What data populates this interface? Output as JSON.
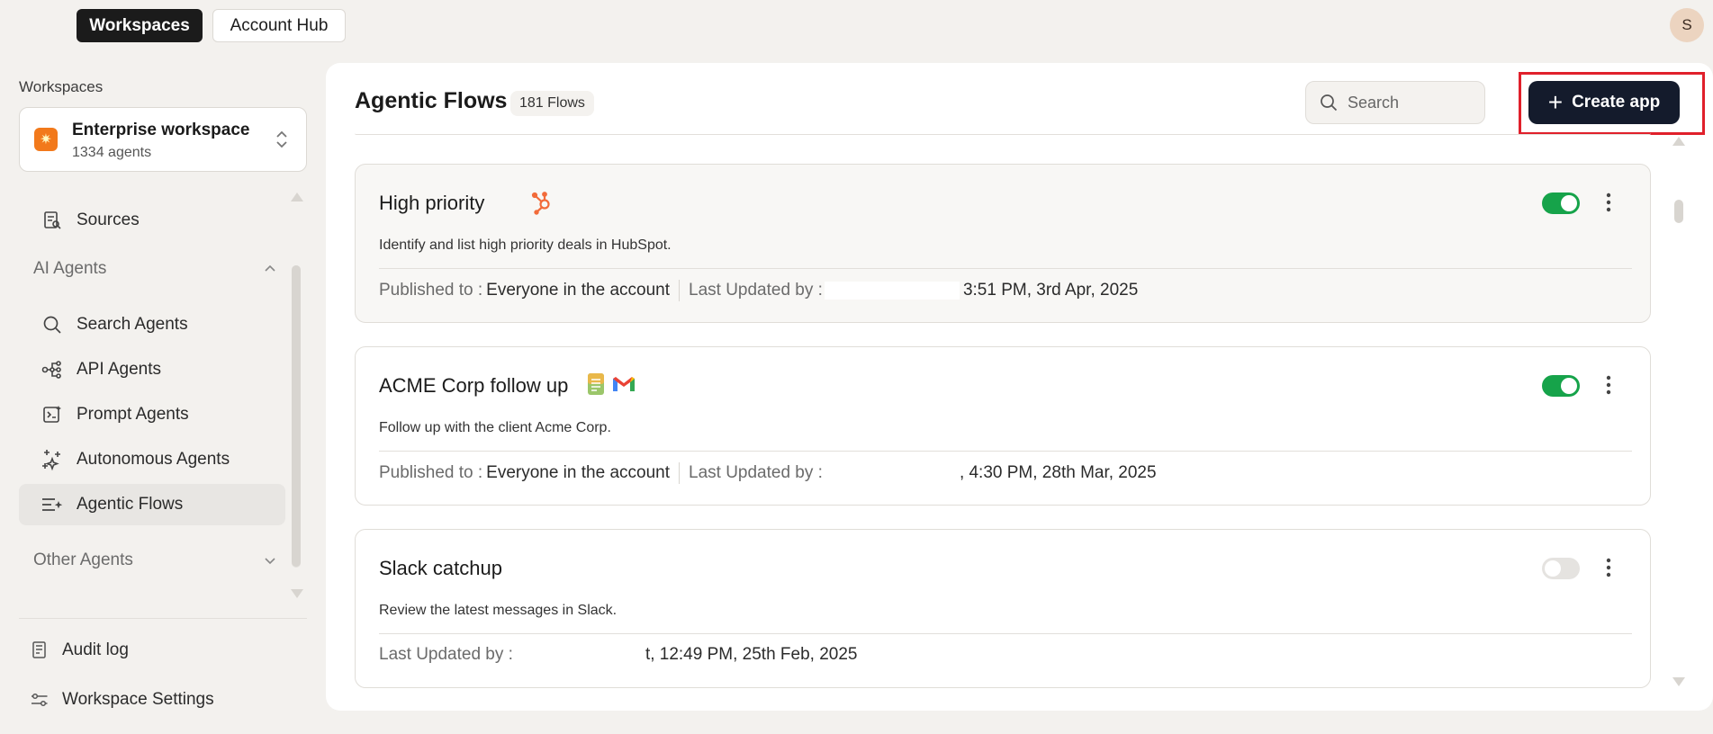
{
  "topbar": {
    "tabs": [
      {
        "label": "Workspaces",
        "active": true
      },
      {
        "label": "Account Hub",
        "active": false
      }
    ],
    "avatar_initial": "S"
  },
  "sidebar": {
    "workspaces_heading": "Workspaces",
    "workspace": {
      "name": "Enterprise workspace",
      "count": "1334 agents",
      "logo_icon": "sun-icon",
      "logo_color": "#f2791b"
    },
    "sources_label": "Sources",
    "ai_agents_section": "AI Agents",
    "items": [
      {
        "label": "Search Agents",
        "icon": "search-icon"
      },
      {
        "label": "API Agents",
        "icon": "api-graph-icon"
      },
      {
        "label": "Prompt Agents",
        "icon": "prompt-icon"
      },
      {
        "label": "Autonomous Agents",
        "icon": "sparkles-icon"
      },
      {
        "label": "Agentic Flows",
        "icon": "flows-icon",
        "active": true
      }
    ],
    "other_agents_section": "Other Agents",
    "audit_log": "Audit log",
    "workspace_settings": "Workspace Settings"
  },
  "main": {
    "title": "Agentic Flows",
    "count_badge": "181 Flows",
    "search": {
      "placeholder": "Search",
      "value": ""
    },
    "create_button": "Create app",
    "highlight_color": "#e0202b",
    "flows": [
      {
        "title": "High priority",
        "description": "Identify and list high priority deals in HubSpot.",
        "published_label": "Published to :",
        "published_value": "Everyone in the account",
        "updated_label": "Last Updated by :",
        "updated_value": "3:51 PM, 3rd Apr, 2025",
        "enabled": true,
        "icons": [
          "hubspot-icon"
        ]
      },
      {
        "title": "ACME Corp follow up",
        "description": "Follow up with the client Acme Corp.",
        "published_label": "Published to :",
        "published_value": "Everyone in the account",
        "updated_label": "Last Updated by :",
        "updated_value": ", 4:30 PM, 28th Mar, 2025",
        "enabled": true,
        "icons": [
          "notes-icon",
          "gmail-icon"
        ]
      },
      {
        "title": "Slack catchup",
        "description": "Review the latest messages in Slack.",
        "updated_label": "Last Updated by :",
        "updated_value": "t, 12:49 PM, 25th Feb, 2025",
        "enabled": false,
        "icons": []
      }
    ]
  },
  "colors": {
    "toggle_on": "#16a34a",
    "create_button": "#141b2c"
  }
}
